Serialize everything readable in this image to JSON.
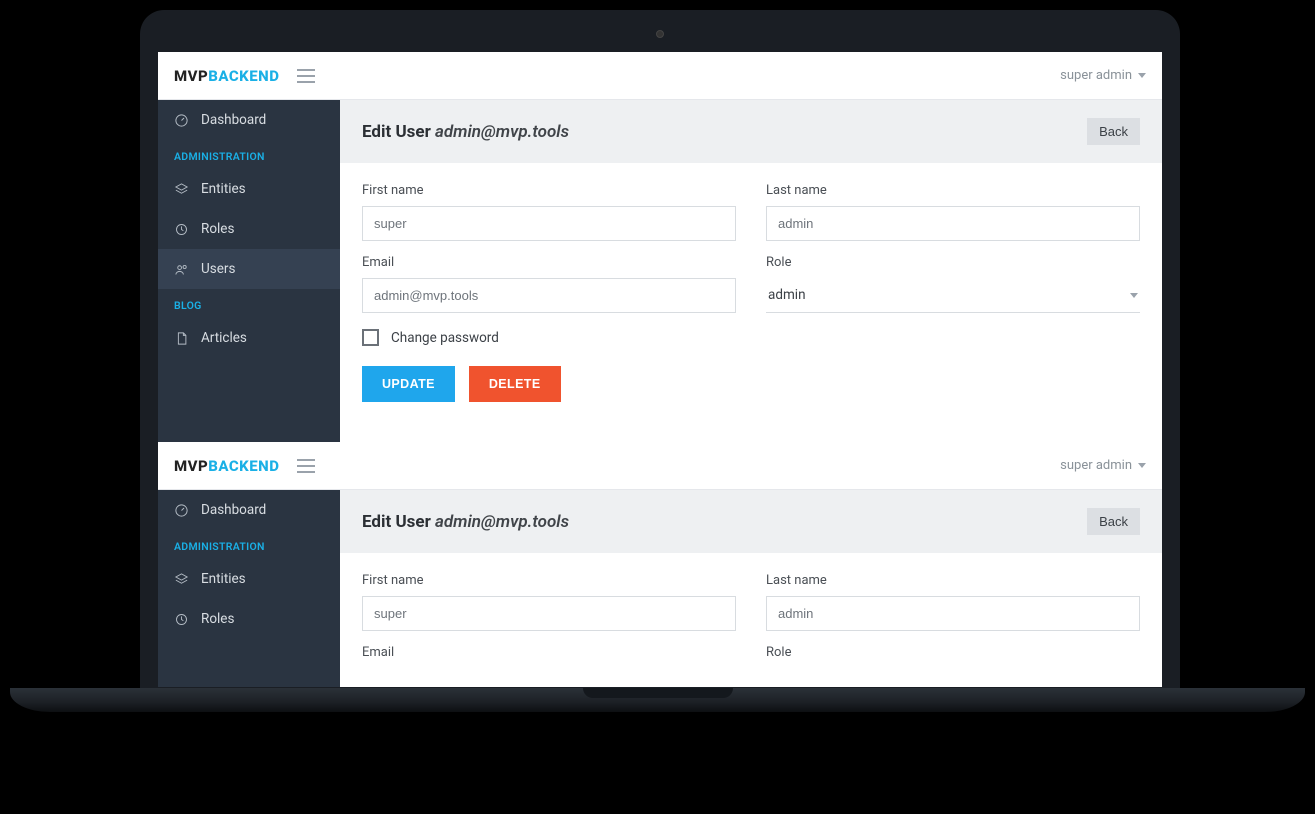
{
  "brand": {
    "part1": "MVP",
    "part2": "BACKEND"
  },
  "topbar": {
    "user_label": "super admin"
  },
  "sidebar": {
    "dashboard": "Dashboard",
    "section_administration": "ADMINISTRATION",
    "entities": "Entities",
    "roles": "Roles",
    "users": "Users",
    "section_blog": "BLOG",
    "articles": "Articles"
  },
  "page": {
    "title_prefix": "Edit User",
    "title_subject": "admin@mvp.tools",
    "back_label": "Back"
  },
  "form": {
    "first_name_label": "First name",
    "first_name_value": "super",
    "last_name_label": "Last name",
    "last_name_value": "admin",
    "email_label": "Email",
    "email_value": "admin@mvp.tools",
    "role_label": "Role",
    "role_value": "admin",
    "change_password_label": "Change password",
    "update_label": "UPDATE",
    "delete_label": "DELETE"
  }
}
